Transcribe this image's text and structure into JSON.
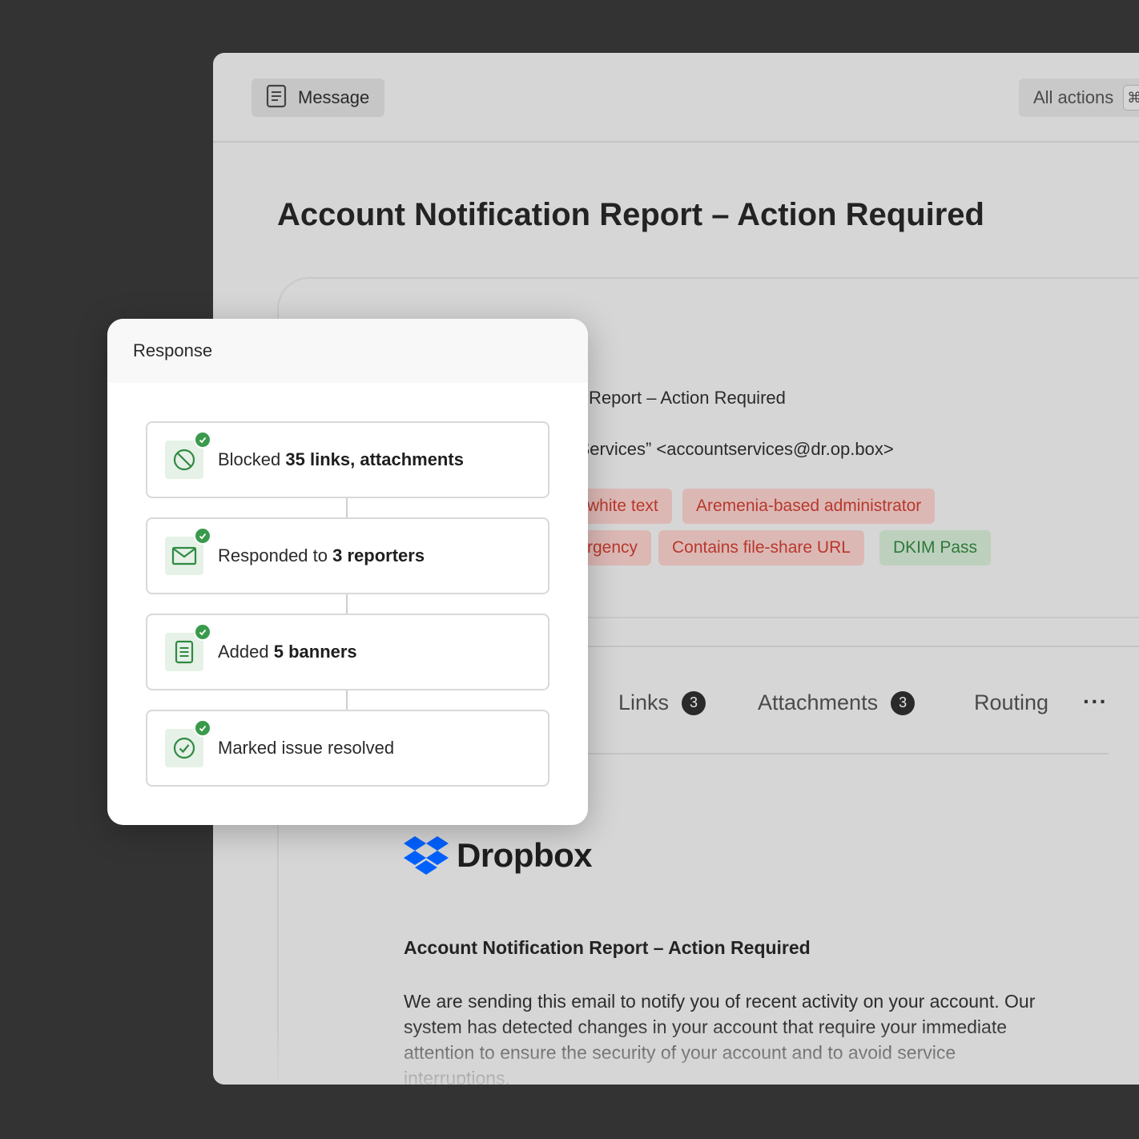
{
  "toolbar": {
    "message_label": "Message",
    "all_actions_label": "All actions",
    "shortcut_key": "⌘"
  },
  "email_header": {
    "title": "Account Notification Report – Action Required",
    "subject_visible": "otification Report – Action Required",
    "from_visible": "Account Services” <accountservices@dr.op.box>",
    "tags": [
      {
        "label": "white text",
        "status": "red"
      },
      {
        "label": "Aremenia-based administrator",
        "status": "red"
      },
      {
        "label": "rgency",
        "status": "red"
      },
      {
        "label": "Contains file-share URL",
        "status": "red"
      },
      {
        "label": "DKIM Pass",
        "status": "green"
      }
    ]
  },
  "tabs": {
    "links": {
      "label": "Links",
      "count": "3"
    },
    "attachments": {
      "label": "Attachments",
      "count": "3"
    },
    "routing": {
      "label": "Routing"
    },
    "more": "···"
  },
  "email_body": {
    "brand": "Dropbox",
    "title": "Account Notification Report – Action Required",
    "paragraph": "We are sending this email to notify you of recent activity on your account. Our system has detected changes in your account that require your immediate attention to ensure the security of your account and to avoid service interruptions."
  },
  "response_panel": {
    "title": "Response",
    "steps": [
      {
        "prefix": "Blocked ",
        "bold": "35 links, attachments",
        "icon": "block-icon"
      },
      {
        "prefix": "Responded to ",
        "bold": "3 reporters",
        "icon": "mail-icon"
      },
      {
        "prefix": "Added ",
        "bold": "5 banners",
        "icon": "document-icon"
      },
      {
        "prefix": "Marked issue resolved",
        "bold": "",
        "icon": "check-circle-icon"
      }
    ]
  },
  "colors": {
    "accent_green": "#3a9a4c",
    "tag_red_text": "#b8382c",
    "tag_green_text": "#2e7a3a",
    "dropbox_blue": "#0061fe"
  }
}
